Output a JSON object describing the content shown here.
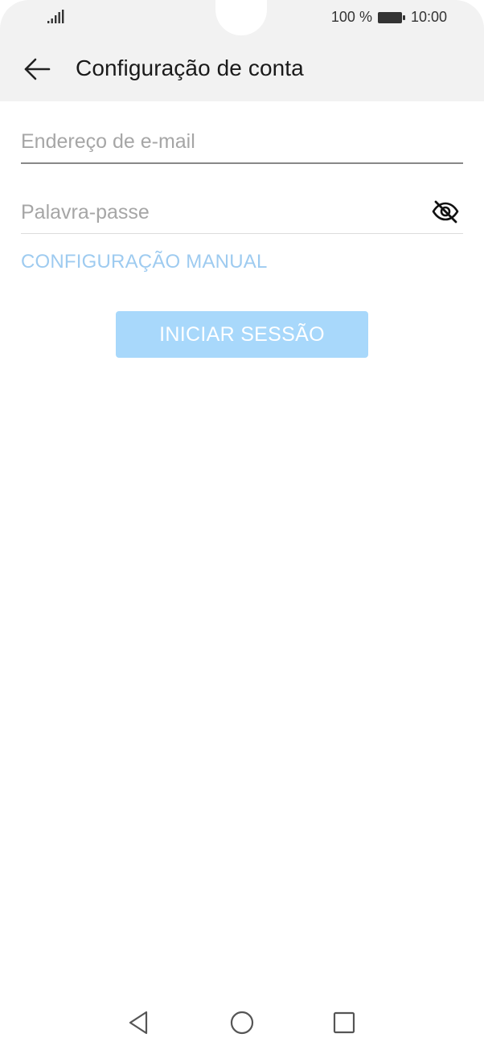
{
  "status_bar": {
    "battery_percent": "100 %",
    "time": "10:00",
    "signal_icon": "signal-icon",
    "battery_icon": "battery-icon"
  },
  "app_bar": {
    "title": "Configuração de conta",
    "back_icon": "arrow-left-icon"
  },
  "form": {
    "email": {
      "placeholder": "Endereço de e-mail",
      "value": ""
    },
    "password": {
      "placeholder": "Palavra-passe",
      "value": "",
      "toggle_icon": "eye-off-icon"
    },
    "manual_setup_label": "CONFIGURAÇÃO MANUAL",
    "login_label": "INICIAR SESSÃO"
  },
  "nav_bar": {
    "back_icon": "triangle-back-icon",
    "home_icon": "circle-home-icon",
    "recent_icon": "square-recent-icon"
  },
  "colors": {
    "header_bg": "#f2f2f2",
    "link": "#9ecbf0",
    "button_bg": "#a8d8fb",
    "placeholder": "#a6a6a6"
  }
}
